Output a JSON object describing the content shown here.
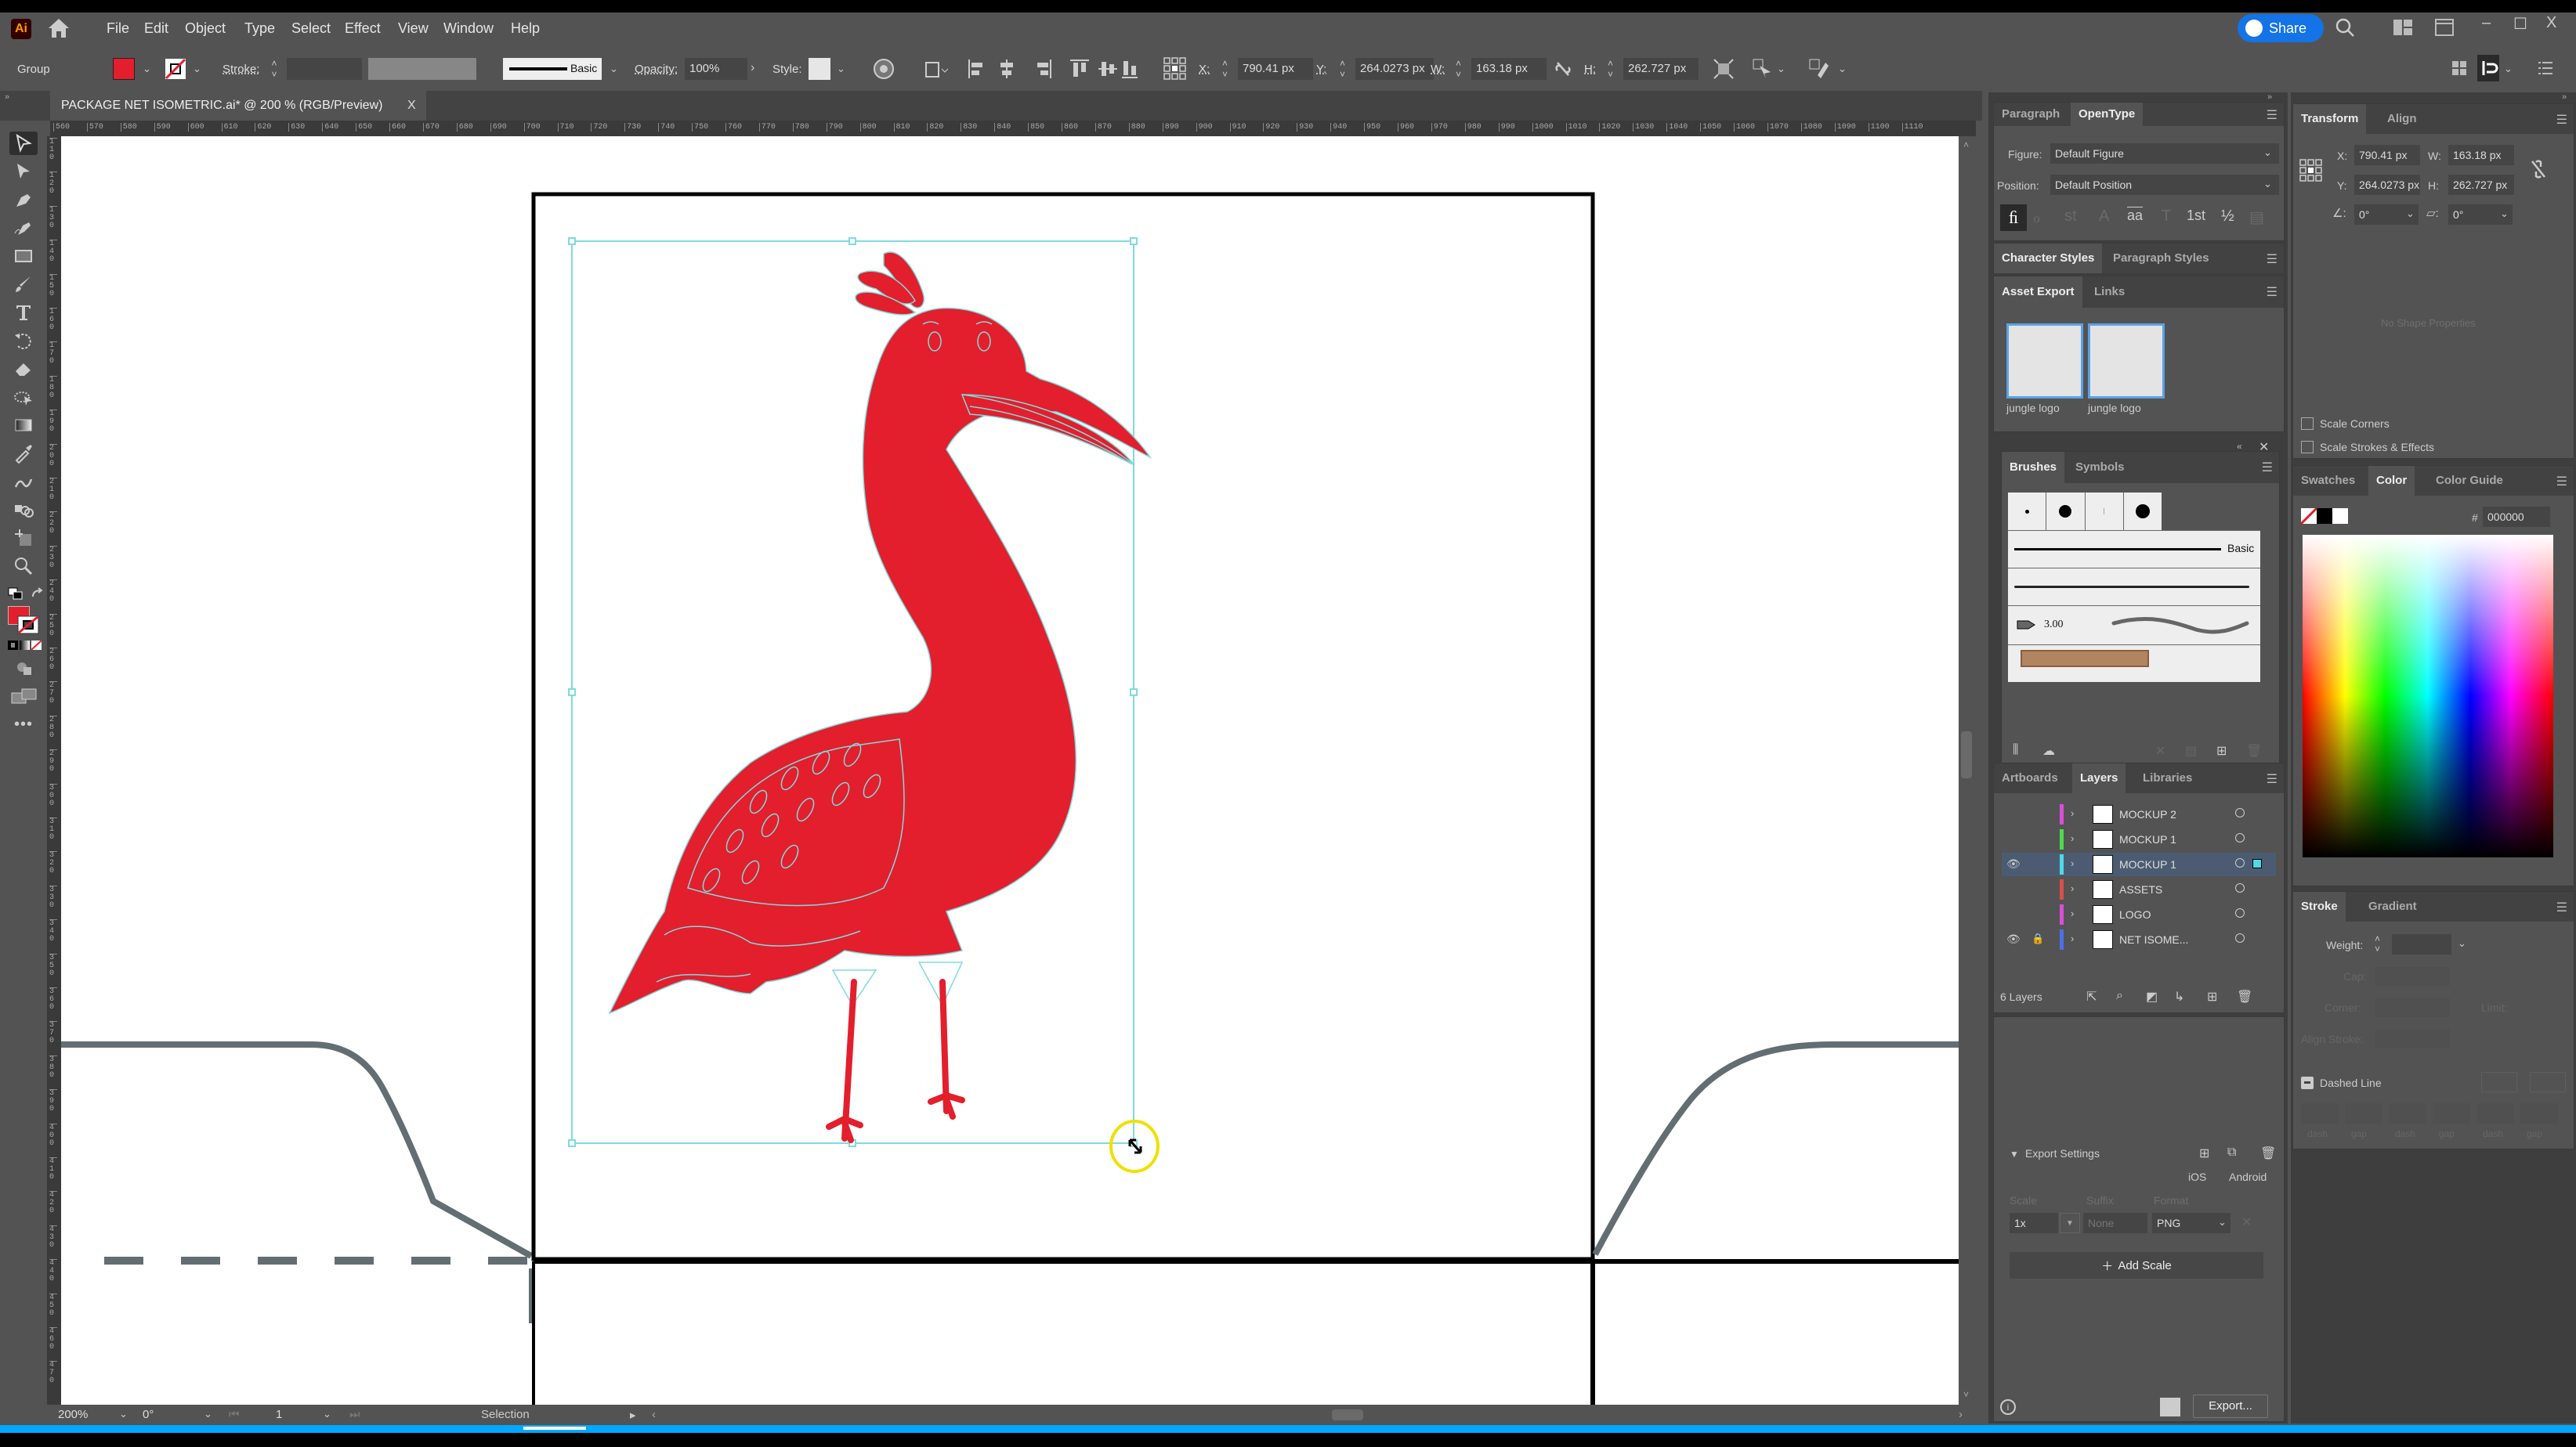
{
  "app": {
    "logo": "Ai",
    "menu": [
      "File",
      "Edit",
      "Object",
      "Type",
      "Select",
      "Effect",
      "View",
      "Window",
      "Help"
    ],
    "share_label": "Share",
    "window_controls": {
      "minimize": "–",
      "maximize": "☐",
      "close": "X"
    }
  },
  "controlbar": {
    "selection_type": "Group",
    "fill_color": "#e31e2d",
    "stroke_label": "Stroke:",
    "stroke_value": "",
    "brush_label": "Basic",
    "opacity_label": "Opacity:",
    "opacity_value": "100%",
    "style_label": "Style:",
    "x_label": "X:",
    "x_value": "790.41 px",
    "y_label": "Y:",
    "y_value": "264.0273 px",
    "w_label": "W:",
    "w_value": "163.18 px",
    "h_label": "H:",
    "h_value": "262.727 px"
  },
  "document": {
    "tab_title": "PACKAGE NET ISOMETRIC.ai* @ 200 % (RGB/Preview)",
    "close": "X"
  },
  "rulers": {
    "horizontal": [
      "560",
      "570",
      "580",
      "590",
      "600",
      "610",
      "620",
      "630",
      "640",
      "650",
      "660",
      "670",
      "680",
      "690",
      "700",
      "710",
      "720",
      "730",
      "740",
      "750",
      "760",
      "770",
      "780",
      "790",
      "800",
      "810",
      "820",
      "830",
      "840",
      "850",
      "860",
      "870",
      "880",
      "890",
      "900",
      "910",
      "920",
      "930",
      "940",
      "950",
      "960",
      "970",
      "980",
      "990",
      "1000",
      "1010",
      "1020",
      "1030",
      "1040",
      "1050",
      "1060",
      "1070",
      "1080",
      "1090",
      "1100",
      "1110"
    ],
    "vertical": [
      "110",
      "120",
      "130",
      "140",
      "150",
      "160",
      "170",
      "180",
      "190",
      "200",
      "210",
      "220",
      "230",
      "240",
      "250",
      "260",
      "270",
      "280",
      "290",
      "300",
      "310",
      "320",
      "330",
      "340",
      "350",
      "360",
      "370",
      "380",
      "390",
      "400",
      "410",
      "420",
      "430",
      "440",
      "450",
      "460",
      "470"
    ]
  },
  "toolbar": {
    "tools": [
      "selection-tool",
      "direct-selection-tool",
      "pen-tool",
      "curvature-tool",
      "rectangle-tool",
      "paintbrush-tool",
      "type-tool",
      "rotate-tool",
      "eraser-tool",
      "shape-builder-tool",
      "gradient-tool",
      "eyedropper-tool",
      "puppet-warp-tool",
      "blend-tool",
      "artboard-tool",
      "zoom-tool"
    ],
    "fill_color": "#e31e2d",
    "more": "•••"
  },
  "canvas": {
    "artwork_color": "#e31e2d",
    "net_line_color": "#636e72",
    "selection_color": "#7fdbdb"
  },
  "statusbar": {
    "zoom": "200%",
    "rotation": "0°",
    "artboard": "1",
    "tool": "Selection"
  },
  "opentype_panel": {
    "tabs": [
      "Paragraph",
      "OpenType"
    ],
    "active_tab": "OpenType",
    "figure_label": "Figure:",
    "figure_value": "Default Figure",
    "position_label": "Position:",
    "position_value": "Default Position",
    "glyph_buttons": [
      "ﬁ",
      "ℴ",
      "st",
      "A",
      "aa",
      "T",
      "1st",
      "½",
      "▤"
    ]
  },
  "styles_panel": {
    "tabs": [
      "Character Styles",
      "Paragraph Styles"
    ],
    "active_tab": "Character Styles"
  },
  "asset_export_panel": {
    "tabs": [
      "Asset Export",
      "Links"
    ],
    "active_tab": "Asset Export",
    "assets": [
      {
        "name": "jungle logo"
      },
      {
        "name": "jungle logo"
      }
    ],
    "export_settings_label": "Export Settings",
    "ios_label": "iOS",
    "android_label": "Android",
    "scale_header": "Scale",
    "suffix_header": "Suffix",
    "format_header": "Format",
    "scale_value": "1x",
    "suffix_placeholder": "None",
    "format_value": "PNG",
    "add_scale_label": "Add Scale",
    "export_button": "Export..."
  },
  "brushes_panel": {
    "tabs": [
      "Brushes",
      "Symbols"
    ],
    "active_tab": "Brushes",
    "basic_label": "Basic",
    "size_label": "3.00"
  },
  "layers_panel": {
    "tabs": [
      "Artboards",
      "Layers",
      "Libraries"
    ],
    "active_tab": "Layers",
    "layers": [
      {
        "name": "MOCKUP 2",
        "color": "#d94fd9",
        "visible": false,
        "locked": false,
        "selected": false
      },
      {
        "name": "MOCKUP 1",
        "color": "#4fd94f",
        "visible": false,
        "locked": false,
        "selected": false
      },
      {
        "name": "MOCKUP 1",
        "color": "#4fd9e6",
        "visible": true,
        "locked": false,
        "selected": true
      },
      {
        "name": "ASSETS",
        "color": "#d94f4f",
        "visible": false,
        "locked": false,
        "selected": false
      },
      {
        "name": "LOGO",
        "color": "#d94fd9",
        "visible": false,
        "locked": false,
        "selected": false
      },
      {
        "name": "NET ISOME...",
        "color": "#4f6fe6",
        "visible": true,
        "locked": true,
        "selected": false
      }
    ],
    "count_label": "6 Layers"
  },
  "transform_panel": {
    "tabs": [
      "Transform",
      "Align"
    ],
    "active_tab": "Transform",
    "x_label": "X:",
    "x_value": "790.41 px",
    "y_label": "Y:",
    "y_value": "264.0273 px",
    "w_label": "W:",
    "w_value": "163.18 px",
    "h_label": "H:",
    "h_value": "262.727 px",
    "rotate_value": "0°",
    "shear_value": "0°",
    "no_shape": "No Shape Properties",
    "scale_corners": "Scale Corners",
    "scale_strokes": "Scale Strokes & Effects"
  },
  "color_panel": {
    "tabs": [
      "Swatches",
      "Color",
      "Color Guide"
    ],
    "active_tab": "Color",
    "hex_label": "#",
    "hex_value": "000000"
  },
  "stroke_panel": {
    "tabs": [
      "Stroke",
      "Gradient"
    ],
    "active_tab": "Stroke",
    "weight_label": "Weight:",
    "cap_label": "Cap:",
    "corner_label": "Corner:",
    "limit_label": "Limit:",
    "align_label": "Align Stroke:",
    "dashed_label": "Dashed Line",
    "dash_labels": [
      "dash",
      "gap",
      "dash",
      "gap",
      "dash",
      "gap"
    ]
  }
}
